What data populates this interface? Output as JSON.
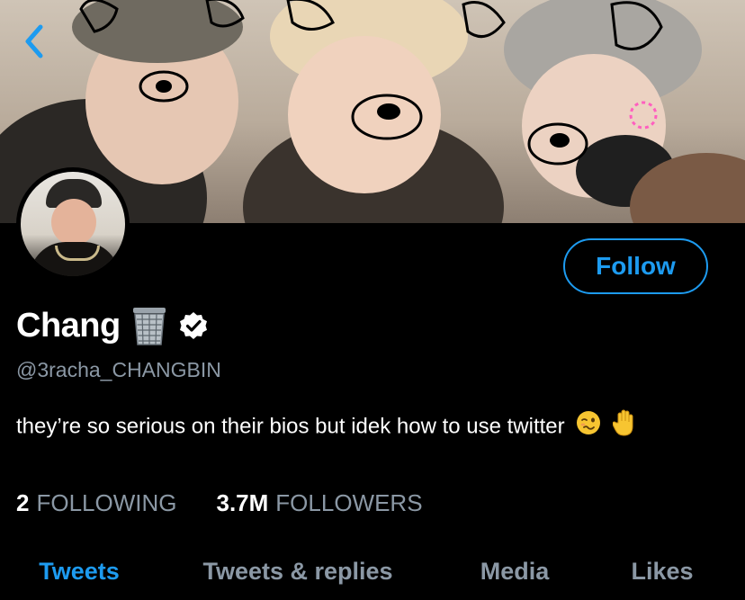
{
  "profile": {
    "display_name": "Chang",
    "handle": "@3racha_CHANGBIN",
    "bio": "they’re so serious on their bios but idek how to use twitter",
    "verified": true,
    "name_emoji": "wastebasket-icon",
    "bio_emojis": [
      "woozy-face-icon",
      "raised-hand-icon"
    ]
  },
  "actions": {
    "follow_label": "Follow",
    "back_icon": "chevron-left-icon"
  },
  "stats": {
    "following_count": "2",
    "following_label": "FOLLOWING",
    "followers_count": "3.7M",
    "followers_label": "FOLLOWERS"
  },
  "tabs": [
    {
      "label": "Tweets",
      "active": true
    },
    {
      "label": "Tweets & replies",
      "active": false
    },
    {
      "label": "Media",
      "active": false
    },
    {
      "label": "Likes",
      "active": false
    }
  ],
  "colors": {
    "accent": "#1d9bf0",
    "background": "#000000",
    "secondary_text": "#8b98a5",
    "verified_badge": "#ffffff"
  }
}
